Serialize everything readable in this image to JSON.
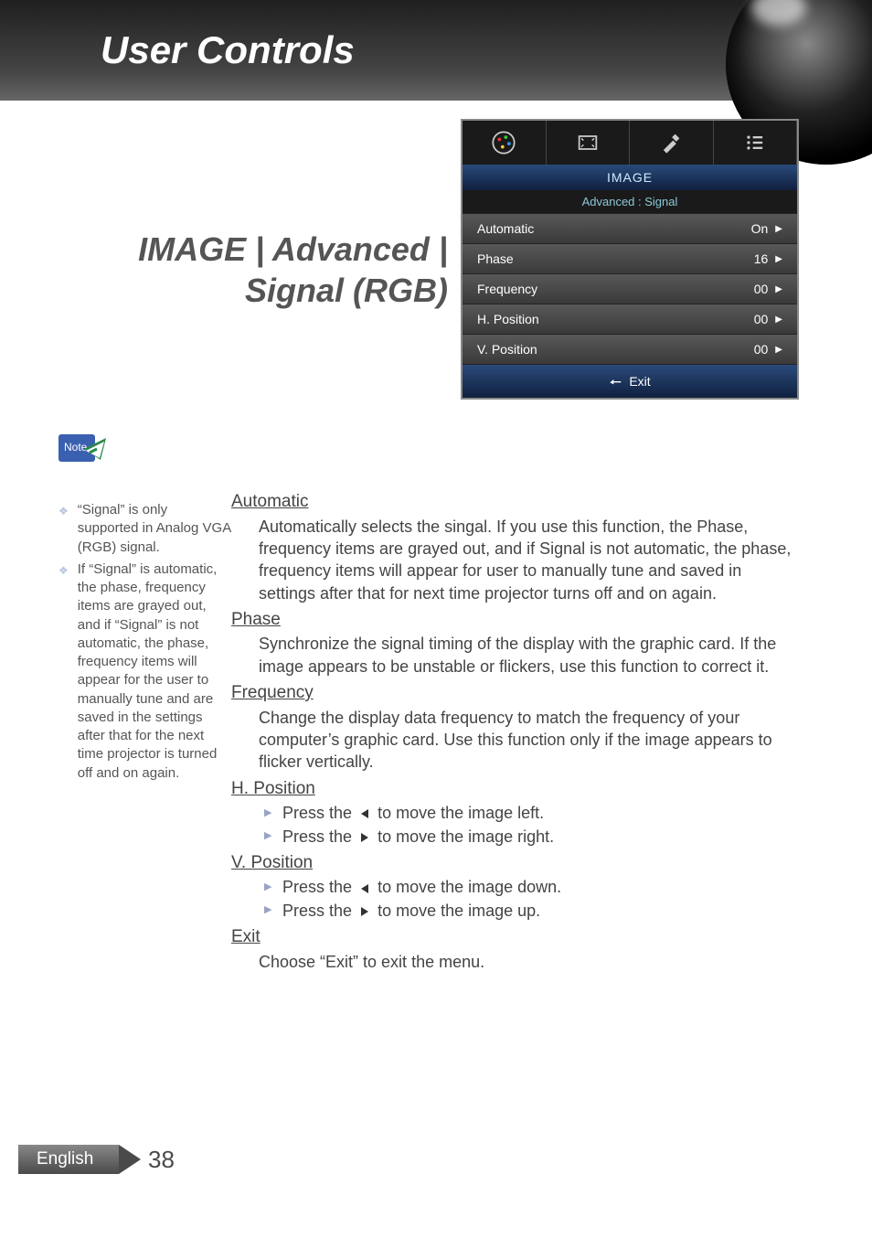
{
  "header": {
    "title": "User Controls"
  },
  "page_title": "IMAGE | Advanced | Signal (RGB)",
  "osd": {
    "title": "IMAGE",
    "subtitle": "Advanced : Signal",
    "rows": [
      {
        "label": "Automatic",
        "value": "On"
      },
      {
        "label": "Phase",
        "value": "16"
      },
      {
        "label": "Frequency",
        "value": "00"
      },
      {
        "label": "H. Position",
        "value": "00"
      },
      {
        "label": "V. Position",
        "value": "00"
      }
    ],
    "exit": "Exit"
  },
  "note_label": "Note",
  "side_notes": [
    "“Signal” is only supported in Analog VGA (RGB) signal.",
    "If “Signal” is automatic, the phase, frequency items are grayed out, and if “Signal” is not automatic, the phase, frequency items will  appear for the user to manually tune and are saved in the settings after that for the next time projector is turned off and on again."
  ],
  "sections": {
    "automatic": {
      "heading": "Automatic",
      "body": "Automatically selects the singal. If you use this function, the Phase, frequency items are grayed out, and if Signal is not automatic, the phase, frequency items will appear for user to manually tune and saved in settings after that for next time projector turns off and on again."
    },
    "phase": {
      "heading": "Phase",
      "body": "Synchronize the signal timing of the display with the graphic card. If the image appears to be unstable or flickers, use this function to correct it."
    },
    "frequency": {
      "heading": "Frequency",
      "body": "Change the display data frequency to match the frequency of your computer’s graphic card. Use this function only if the image appears to flicker vertically."
    },
    "hpos": {
      "heading": "H. Position",
      "items": {
        "left_pre": "Press the ",
        "left_post": " to move the image left.",
        "right_pre": "Press the ",
        "right_post": " to move the image right."
      }
    },
    "vpos": {
      "heading": "V. Position",
      "items": {
        "down_pre": "Press the ",
        "down_post": " to move the image down.",
        "up_pre": "Press the ",
        "up_post": " to move the image up."
      }
    },
    "exit": {
      "heading": "Exit",
      "body": "Choose “Exit” to exit the menu."
    }
  },
  "footer": {
    "lang": "English",
    "page": "38"
  }
}
